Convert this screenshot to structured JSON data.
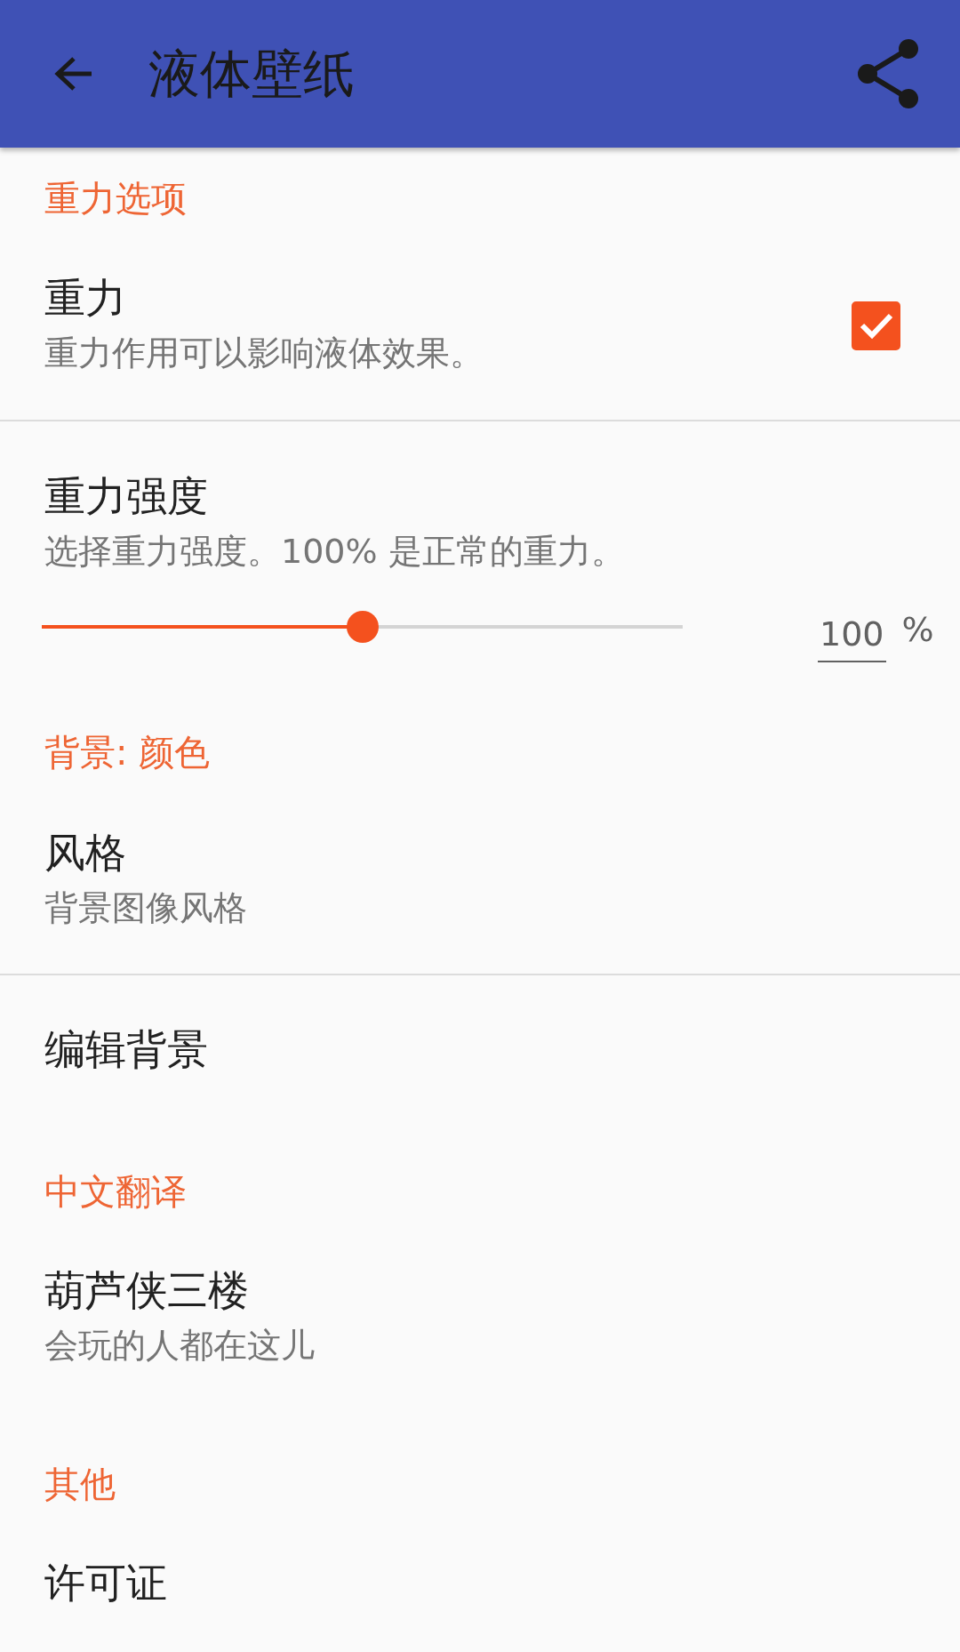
{
  "app_bar": {
    "title": "液体壁纸"
  },
  "sections": [
    {
      "header": "重力选项",
      "items": [
        {
          "kind": "checkbox",
          "title": "重力",
          "summary": "重力作用可以影响液体效果。",
          "checked": true
        },
        {
          "kind": "slider",
          "title": "重力强度",
          "summary": "选择重力强度。100% 是正常的重力。",
          "level": 0.5,
          "value": "100",
          "unit": "%"
        }
      ]
    },
    {
      "header": "背景: 颜色",
      "items": [
        {
          "kind": "text",
          "title": "风格",
          "summary": "背景图像风格"
        },
        {
          "kind": "text",
          "title": "编辑背景"
        }
      ]
    },
    {
      "header": "中文翻译",
      "items": [
        {
          "kind": "text",
          "title": "葫芦侠三楼",
          "summary": "会玩的人都在这儿"
        }
      ]
    },
    {
      "header": "其他",
      "items": [
        {
          "kind": "text",
          "title": "许可证"
        }
      ]
    }
  ]
}
